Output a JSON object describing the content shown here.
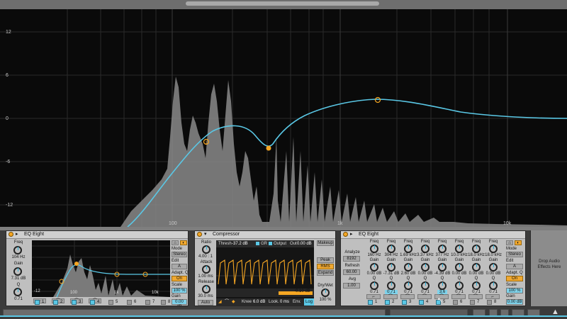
{
  "spectrum": {
    "y_labels": [
      "12",
      "6",
      "0",
      "-6",
      "-12"
    ],
    "x_labels": [
      "100",
      "1k",
      "10k"
    ]
  },
  "eq1": {
    "title": "EQ Eight",
    "freq_label": "Freq",
    "freq_value": "104 Hz",
    "gain_label": "Gain",
    "gain_value": "7.31 dB",
    "q_label": "Q",
    "q_value": "0.71",
    "y_labels": [
      "12",
      "6",
      "0",
      "-6",
      "-12"
    ],
    "x_labels": [
      "100",
      "1k",
      "10k"
    ],
    "adapt_label": "Adapt. Q",
    "adapt_value": "On",
    "mode_label": "Mode",
    "mode_value": "Stereo",
    "edit_label": "Edit",
    "edit_value": "A",
    "scale_label": "Scale",
    "scale_value": "100 %",
    "gain2_label": "Gain",
    "gain2_value": "0.00 dB",
    "band_numbers": [
      "1",
      "2",
      "3",
      "4",
      "5",
      "6",
      "7",
      "8"
    ]
  },
  "compressor": {
    "title": "Compressor",
    "ratio_label": "Ratio",
    "ratio_value": "4.00 : 1",
    "attack_label": "Attack",
    "attack_value": "1.00 ms",
    "release_label": "Release",
    "release_value": "30.0 ms",
    "auto_label": "Auto",
    "thresh_label": "Thresh",
    "thresh_value": "-37.2 dB",
    "gr_label": "GR",
    "output_label": "Output",
    "out_label": "Out",
    "out_value": "0.00 dB",
    "level_value": "-0.10 dB",
    "knee_label": "Knee",
    "knee_value": "6.0 dB",
    "look_label": "Look.",
    "look_value": "0 ms",
    "env_label": "Env.",
    "env_value": "Log",
    "makeup_label": "Makeup",
    "peak_label": "Peak",
    "rms_label": "RMS",
    "expand_label": "Expand",
    "drywet_label": "Dry/Wet",
    "drywet_value": "100 %"
  },
  "eq2": {
    "title": "EQ Eight",
    "analyze_label": "Analyze",
    "block_value": "8192",
    "refresh_label": "Refresh",
    "refresh_value": "60.00",
    "avg_label": "Avg",
    "avg_value": "1.00",
    "bands": [
      {
        "freq": "160 Hz",
        "gain": "0.00 dB",
        "q": "0.71",
        "num": "1"
      },
      {
        "freq": "304 Hz",
        "gain": "-7.31 dB",
        "q": "0.71",
        "num": "2"
      },
      {
        "freq": "1.69 kHz",
        "gain": "2.60 dB",
        "q": "0.71",
        "num": "3"
      },
      {
        "freq": "3.37 kHz",
        "gain": "0.00 dB",
        "q": "0.71",
        "num": "4"
      },
      {
        "freq": "377 Hz",
        "gain": "-4.39 dB",
        "q": "3.6",
        "num": "5"
      },
      {
        "freq": "10.0 kHz",
        "gain": "0.00 dB",
        "q": "0.71",
        "num": "6"
      },
      {
        "freq": "18.0 kHz",
        "gain": "0.00 dB",
        "q": "0.71",
        "num": "7"
      },
      {
        "freq": "18.0 kHz",
        "gain": "0.00 dB",
        "q": "0.71",
        "num": "8"
      }
    ],
    "freq_label": "Freq",
    "gain_label": "Gain",
    "q_label": "Q",
    "mode_label": "Mode",
    "mode_value": "Stereo",
    "edit_label": "Edit",
    "edit_value": "A",
    "adapt_label": "Adapt. Q",
    "adapt_value": "On",
    "scale_label": "Scale",
    "scale_value": "100 %",
    "gain2_label": "Gain",
    "gain2_value": "0.00 dB"
  },
  "drop_zone": {
    "text": "Drop Audio Effects Here"
  },
  "colors": {
    "accent_orange": "#f5a623",
    "curve_cyan": "#5ac8e6"
  }
}
